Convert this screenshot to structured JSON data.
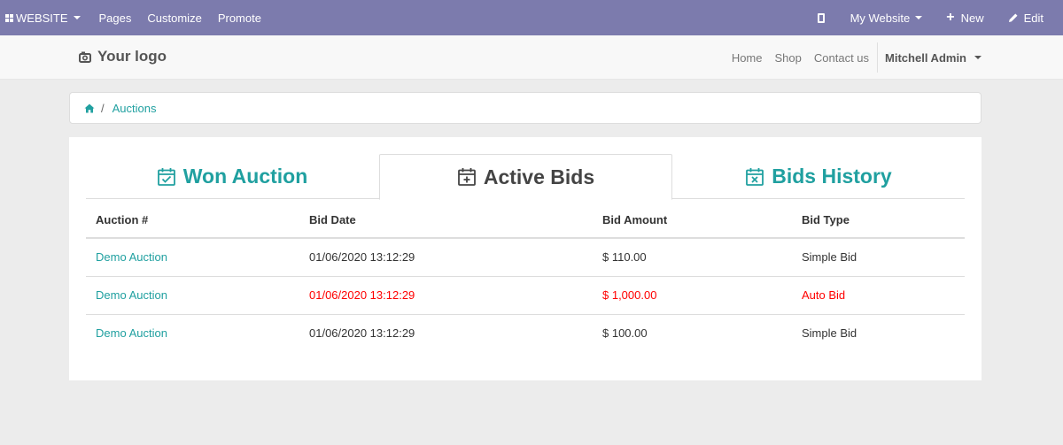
{
  "admin_bar": {
    "website_label": "WEBSITE",
    "pages_label": "Pages",
    "customize_label": "Customize",
    "promote_label": "Promote",
    "my_website_label": "My Website",
    "new_label": "New",
    "edit_label": "Edit",
    "color": "#7c7bad"
  },
  "header": {
    "logo_text": "Your logo",
    "nav": [
      "Home",
      "Shop",
      "Contact us"
    ],
    "user_name": "Mitchell Admin"
  },
  "breadcrumb": {
    "items": [
      "Auctions"
    ]
  },
  "tabs": [
    {
      "label": "Won Auction",
      "icon": "calendar-check-icon",
      "active": false
    },
    {
      "label": "Active Bids",
      "icon": "calendar-plus-icon",
      "active": true
    },
    {
      "label": "Bids History",
      "icon": "calendar-times-icon",
      "active": false
    }
  ],
  "table": {
    "columns": [
      "Auction #",
      "Bid Date",
      "Bid Amount",
      "Bid Type"
    ],
    "rows": [
      {
        "auction": "Demo Auction",
        "date": "01/06/2020 13:12:29",
        "amount": "$ 110.00",
        "type": "Simple Bid",
        "highlight": false
      },
      {
        "auction": "Demo Auction",
        "date": "01/06/2020 13:12:29",
        "amount": "$ 1,000.00",
        "type": "Auto Bid",
        "highlight": true
      },
      {
        "auction": "Demo Auction",
        "date": "01/06/2020 13:12:29",
        "amount": "$ 100.00",
        "type": "Simple Bid",
        "highlight": false
      }
    ]
  },
  "colors": {
    "accent": "#20a0a0",
    "highlight": "#ff0000"
  }
}
